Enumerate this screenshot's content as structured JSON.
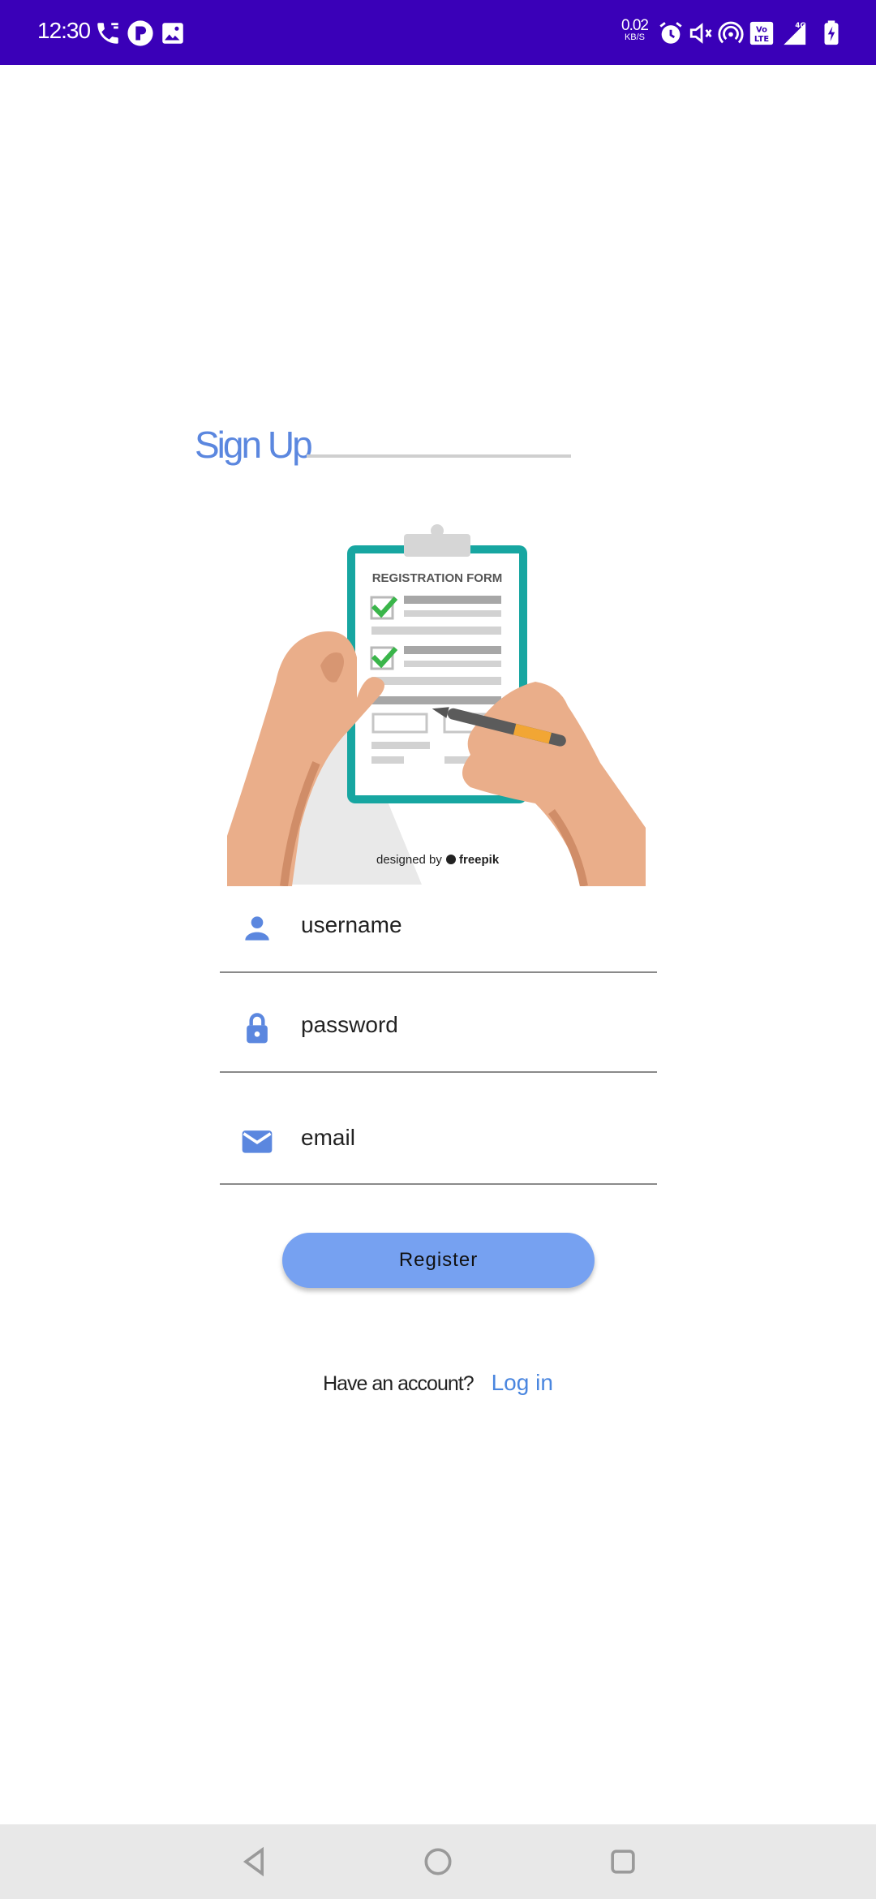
{
  "status_bar": {
    "time": "12:30",
    "net_speed_value": "0.02",
    "net_speed_unit": "KB/S",
    "network_label": "4G",
    "volte_label": "Vo LTE",
    "icons": [
      "phone-icon",
      "app-notification-icon",
      "image-icon",
      "alarm-icon",
      "vibrate-icon",
      "hotspot-icon",
      "volte-icon",
      "signal-icon",
      "battery-icon"
    ]
  },
  "page": {
    "title": "Sign Up",
    "accent_color": "#5b87df"
  },
  "illustration": {
    "form_heading": "REGISTRATION FORM",
    "credit_prefix": "designed by",
    "credit_brand": "freepik"
  },
  "form": {
    "username_placeholder": "username",
    "password_placeholder": "password",
    "email_placeholder": "email",
    "register_label": "Register"
  },
  "footer": {
    "account_prompt": "Have an account?",
    "login_label": "Log in"
  },
  "nav_bar": {
    "icons": [
      "back-icon",
      "home-icon",
      "recents-icon"
    ]
  }
}
